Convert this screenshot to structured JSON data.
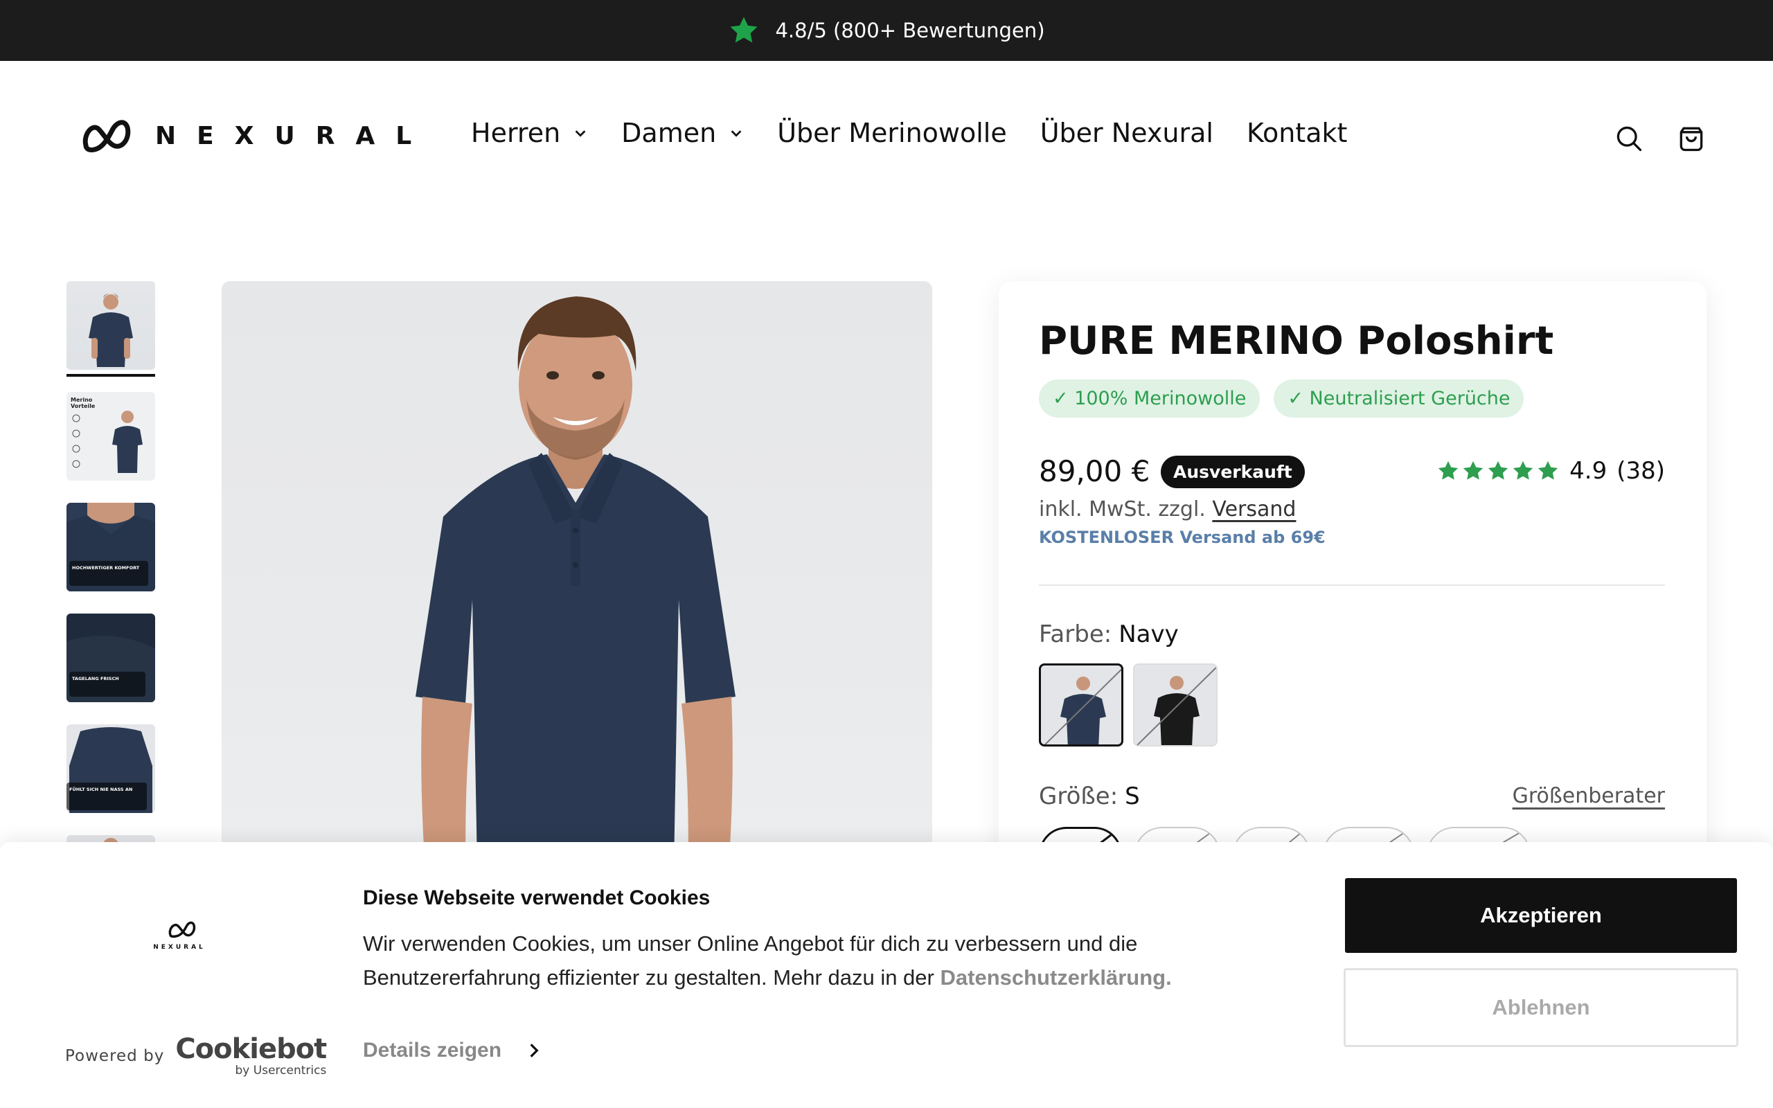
{
  "announcement": {
    "text": "4.8/5 (800+ Bewertungen)",
    "icon": "star-icon",
    "star_color": "#1fa34a"
  },
  "header": {
    "logo_text": "NEXURAL",
    "nav": [
      {
        "label": "Herren",
        "has_dropdown": true
      },
      {
        "label": "Damen",
        "has_dropdown": true
      },
      {
        "label": "Über Merinowolle",
        "has_dropdown": false
      },
      {
        "label": "Über Nexural",
        "has_dropdown": false
      },
      {
        "label": "Kontakt",
        "has_dropdown": false
      }
    ],
    "icons": [
      "search-icon",
      "cart-icon"
    ]
  },
  "gallery": {
    "thumbnails": [
      {
        "name": "model-front",
        "active": true,
        "caption": ""
      },
      {
        "name": "merino-benefits",
        "active": false,
        "caption": "Merino Vorteile"
      },
      {
        "name": "collar-closeup",
        "active": false,
        "caption": "HOCHWERTIGER KOMFORT"
      },
      {
        "name": "fabric-detail",
        "active": false,
        "caption": "TAGELANG FRISCH"
      },
      {
        "name": "model-sleeve",
        "active": false,
        "caption": "FÜHLT SICH NIE NASS AN"
      },
      {
        "name": "model-partial",
        "active": false,
        "caption": ""
      }
    ]
  },
  "product": {
    "title": "PURE MERINO Poloshirt",
    "badges": [
      "✓ 100% Merinowolle",
      "✓ Neutralisiert Gerüche"
    ],
    "price": "89,00 €",
    "status": "Ausverkauft",
    "rating_value": "4.9",
    "rating_count": "(38)",
    "stars": 5,
    "tax_prefix": "inkl. MwSt. zzgl.",
    "tax_link": "Versand",
    "free_shipping": "KOSTENLOSER Versand ab 69€",
    "color_label": "Farbe:",
    "color_value": "Navy",
    "colors": [
      {
        "name": "Navy",
        "hex": "#2b3a52",
        "selected": true
      },
      {
        "name": "Schwarz",
        "hex": "#1a1a1a",
        "selected": false
      }
    ],
    "size_label": "Größe:",
    "size_value": "S",
    "size_guide": "Größenberater"
  },
  "cookie": {
    "title": "Diese Webseite verwendet Cookies",
    "text": "Wir verwenden Cookies, um unser Online Angebot für dich zu verbessern und die Benutzererfahrung effizienter zu gestalten. Mehr dazu in der",
    "policy_link": "Datenschutzerklärung.",
    "details": "Details zeigen",
    "accept": "Akzeptieren",
    "decline": "Ablehnen",
    "powered_by": "Powered by",
    "brand": "Cookiebot",
    "brand_sub": "by Usercentrics",
    "logo_text": "NEXURAL"
  }
}
